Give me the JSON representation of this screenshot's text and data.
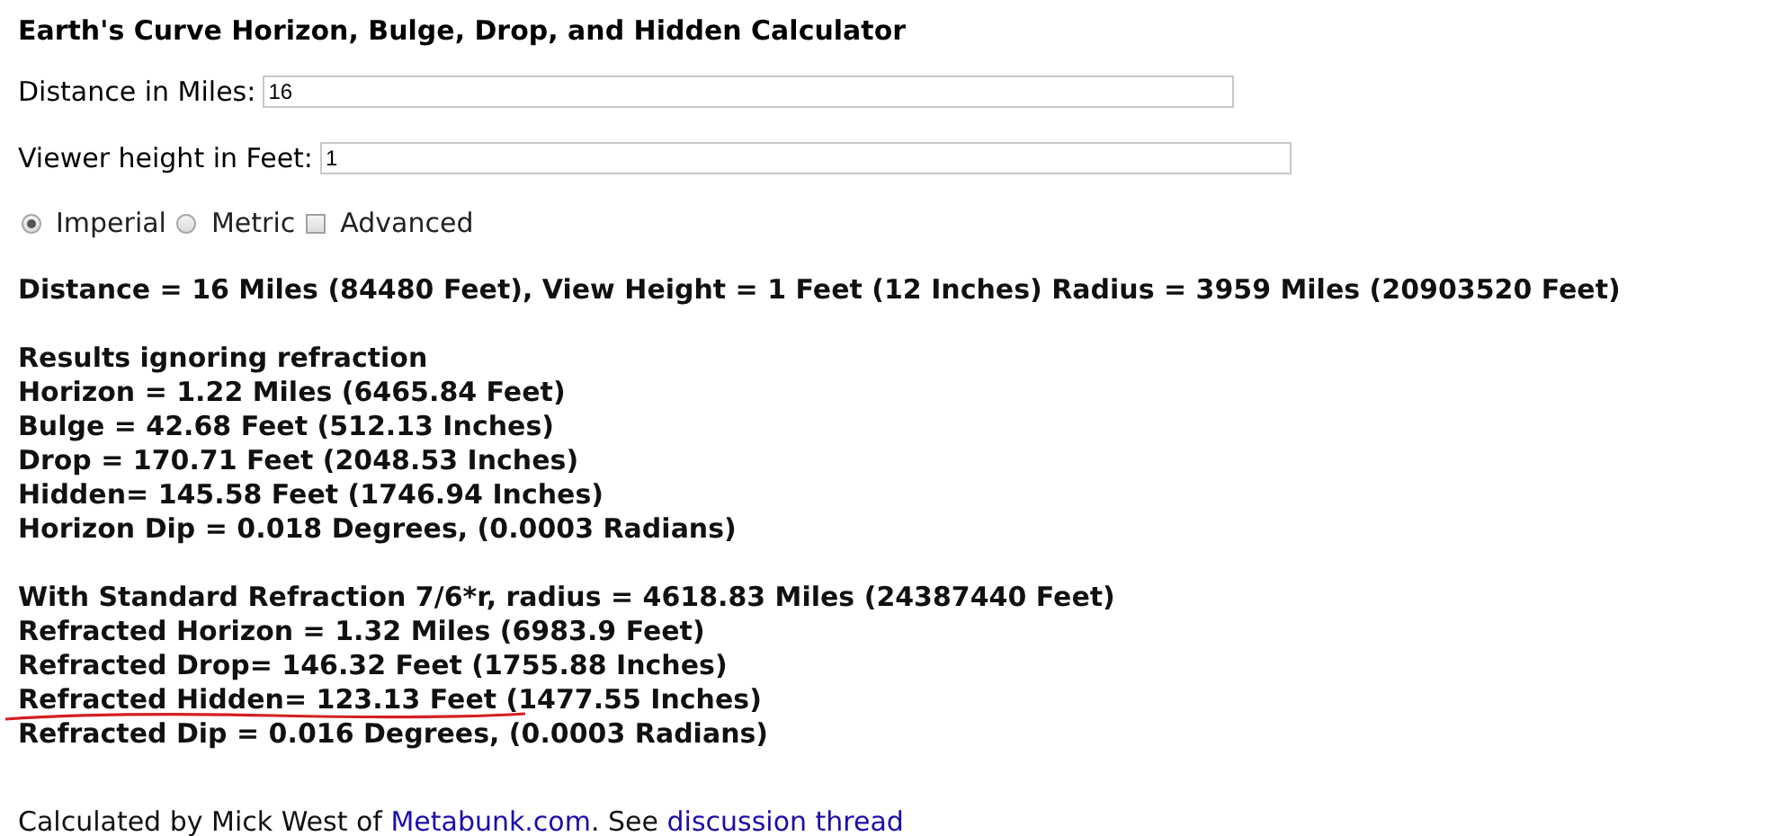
{
  "title": "Earth's Curve Horizon, Bulge, Drop, and Hidden Calculator",
  "fields": [
    {
      "label": "Distance in Miles:",
      "value": "16"
    },
    {
      "label": "Viewer height in Feet:",
      "value": "1"
    }
  ],
  "options": [
    {
      "kind": "radio",
      "label": "Imperial",
      "selected": true
    },
    {
      "kind": "radio",
      "label": "Metric",
      "selected": false
    },
    {
      "kind": "checkbox",
      "label": "Advanced",
      "checked": false
    }
  ],
  "summary": "Distance = 16 Miles (84480 Feet), View Height = 1 Feet (12 Inches) Radius = 3959 Miles (20903520 Feet)",
  "sections": [
    {
      "heading": "Results ignoring refraction",
      "lines": [
        {
          "text": "Horizon = 1.22 Miles (6465.84 Feet)",
          "underlined": false
        },
        {
          "text": "Bulge = 42.68 Feet (512.13 Inches)",
          "underlined": false
        },
        {
          "text": "Drop = 170.71 Feet (2048.53 Inches)",
          "underlined": false
        },
        {
          "text": "Hidden= 145.58 Feet (1746.94 Inches)",
          "underlined": false
        },
        {
          "text": "Horizon Dip = 0.018 Degrees, (0.0003 Radians)",
          "underlined": false
        }
      ]
    },
    {
      "heading": "With Standard Refraction 7/6*r, radius = 4618.83 Miles (24387440 Feet)",
      "lines": [
        {
          "text": "Refracted Horizon = 1.32 Miles (6983.9 Feet)",
          "underlined": false
        },
        {
          "text": "Refracted Drop= 146.32 Feet (1755.88 Inches)",
          "underlined": false
        },
        {
          "text": "Refracted Hidden= 123.13 Feet (1477.55 Inches)",
          "underlined": true
        },
        {
          "text": "Refracted Dip = 0.016 Degrees, (0.0003 Radians)",
          "underlined": false
        }
      ]
    }
  ],
  "footer": [
    {
      "kind": "text",
      "text": "Calculated by Mick West of "
    },
    {
      "kind": "link",
      "text": "Metabunk.com"
    },
    {
      "kind": "text",
      "text": ". See "
    },
    {
      "kind": "link",
      "text": "discussion thread"
    }
  ]
}
